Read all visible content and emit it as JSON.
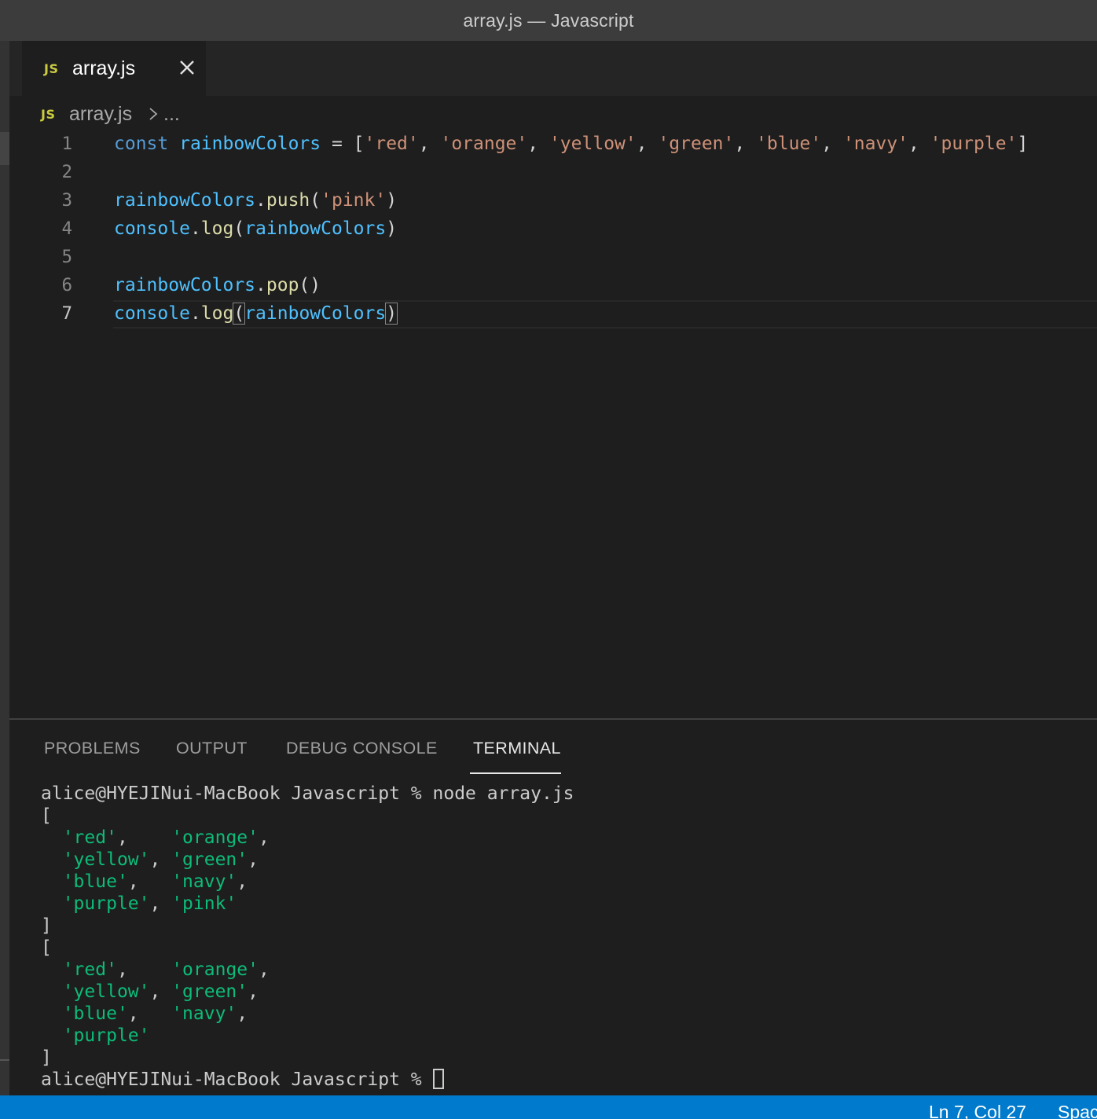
{
  "window": {
    "title": "array.js — Javascript"
  },
  "tab": {
    "icon_text": "JS",
    "label": "array.js",
    "close_icon": "close-icon"
  },
  "breadcrumb": {
    "icon_text": "JS",
    "file": "array.js",
    "more": "..."
  },
  "editor": {
    "current_line": 7,
    "lines": [
      {
        "num": "1",
        "tokens": [
          {
            "t": "const",
            "c": "kw"
          },
          {
            "t": " ",
            "c": "pl"
          },
          {
            "t": "rainbowColors",
            "c": "var"
          },
          {
            "t": " = [",
            "c": "pl"
          },
          {
            "t": "'red'",
            "c": "str"
          },
          {
            "t": ", ",
            "c": "pl"
          },
          {
            "t": "'orange'",
            "c": "str"
          },
          {
            "t": ", ",
            "c": "pl"
          },
          {
            "t": "'yellow'",
            "c": "str"
          },
          {
            "t": ", ",
            "c": "pl"
          },
          {
            "t": "'green'",
            "c": "str"
          },
          {
            "t": ", ",
            "c": "pl"
          },
          {
            "t": "'blue'",
            "c": "str"
          },
          {
            "t": ", ",
            "c": "pl"
          },
          {
            "t": "'navy'",
            "c": "str"
          },
          {
            "t": ", ",
            "c": "pl"
          },
          {
            "t": "'purple'",
            "c": "str"
          },
          {
            "t": "]",
            "c": "pl"
          }
        ]
      },
      {
        "num": "2",
        "tokens": []
      },
      {
        "num": "3",
        "tokens": [
          {
            "t": "rainbowColors",
            "c": "var"
          },
          {
            "t": ".",
            "c": "pl"
          },
          {
            "t": "push",
            "c": "fn"
          },
          {
            "t": "(",
            "c": "pl"
          },
          {
            "t": "'pink'",
            "c": "str"
          },
          {
            "t": ")",
            "c": "pl"
          }
        ]
      },
      {
        "num": "4",
        "tokens": [
          {
            "t": "console",
            "c": "var"
          },
          {
            "t": ".",
            "c": "pl"
          },
          {
            "t": "log",
            "c": "fn"
          },
          {
            "t": "(",
            "c": "pl"
          },
          {
            "t": "rainbowColors",
            "c": "var"
          },
          {
            "t": ")",
            "c": "pl"
          }
        ]
      },
      {
        "num": "5",
        "tokens": []
      },
      {
        "num": "6",
        "tokens": [
          {
            "t": "rainbowColors",
            "c": "var"
          },
          {
            "t": ".",
            "c": "pl"
          },
          {
            "t": "pop",
            "c": "fn"
          },
          {
            "t": "()",
            "c": "pl"
          }
        ]
      },
      {
        "num": "7",
        "tokens": [
          {
            "t": "console",
            "c": "var"
          },
          {
            "t": ".",
            "c": "pl"
          },
          {
            "t": "log",
            "c": "fn"
          },
          {
            "t": "(",
            "c": "pl br"
          },
          {
            "t": "rainbowColors",
            "c": "var"
          },
          {
            "t": ")",
            "c": "pl br"
          }
        ]
      }
    ]
  },
  "panel": {
    "tabs": [
      {
        "label": "PROBLEMS",
        "active": false
      },
      {
        "label": "OUTPUT",
        "active": false
      },
      {
        "label": "DEBUG CONSOLE",
        "active": false
      },
      {
        "label": "TERMINAL",
        "active": true
      }
    ],
    "terminal_lines": [
      [
        {
          "t": "alice@HYEJINui-MacBook Javascript % node array.js",
          "c": ""
        }
      ],
      [
        {
          "t": "[",
          "c": ""
        }
      ],
      [
        {
          "t": "  ",
          "c": ""
        },
        {
          "t": "'red'",
          "c": "tstr"
        },
        {
          "t": ",    ",
          "c": ""
        },
        {
          "t": "'orange'",
          "c": "tstr"
        },
        {
          "t": ",",
          "c": ""
        }
      ],
      [
        {
          "t": "  ",
          "c": ""
        },
        {
          "t": "'yellow'",
          "c": "tstr"
        },
        {
          "t": ", ",
          "c": ""
        },
        {
          "t": "'green'",
          "c": "tstr"
        },
        {
          "t": ",",
          "c": ""
        }
      ],
      [
        {
          "t": "  ",
          "c": ""
        },
        {
          "t": "'blue'",
          "c": "tstr"
        },
        {
          "t": ",   ",
          "c": ""
        },
        {
          "t": "'navy'",
          "c": "tstr"
        },
        {
          "t": ",",
          "c": ""
        }
      ],
      [
        {
          "t": "  ",
          "c": ""
        },
        {
          "t": "'purple'",
          "c": "tstr"
        },
        {
          "t": ", ",
          "c": ""
        },
        {
          "t": "'pink'",
          "c": "tstr"
        }
      ],
      [
        {
          "t": "]",
          "c": ""
        }
      ],
      [
        {
          "t": "[",
          "c": ""
        }
      ],
      [
        {
          "t": "  ",
          "c": ""
        },
        {
          "t": "'red'",
          "c": "tstr"
        },
        {
          "t": ",    ",
          "c": ""
        },
        {
          "t": "'orange'",
          "c": "tstr"
        },
        {
          "t": ",",
          "c": ""
        }
      ],
      [
        {
          "t": "  ",
          "c": ""
        },
        {
          "t": "'yellow'",
          "c": "tstr"
        },
        {
          "t": ", ",
          "c": ""
        },
        {
          "t": "'green'",
          "c": "tstr"
        },
        {
          "t": ",",
          "c": ""
        }
      ],
      [
        {
          "t": "  ",
          "c": ""
        },
        {
          "t": "'blue'",
          "c": "tstr"
        },
        {
          "t": ",   ",
          "c": ""
        },
        {
          "t": "'navy'",
          "c": "tstr"
        },
        {
          "t": ",",
          "c": ""
        }
      ],
      [
        {
          "t": "  ",
          "c": ""
        },
        {
          "t": "'purple'",
          "c": "tstr"
        }
      ],
      [
        {
          "t": "]",
          "c": ""
        }
      ]
    ],
    "prompt": "alice@HYEJINui-MacBook Javascript % "
  },
  "statusbar": {
    "position": "Ln 7, Col 27",
    "spaces": "Spaces"
  },
  "colors": {
    "accent": "#007acc",
    "keyword": "#569cd6",
    "variable": "#4fc1ff",
    "string": "#ce9178",
    "function": "#dcdcaa",
    "terminal_string": "#0dbc79"
  }
}
